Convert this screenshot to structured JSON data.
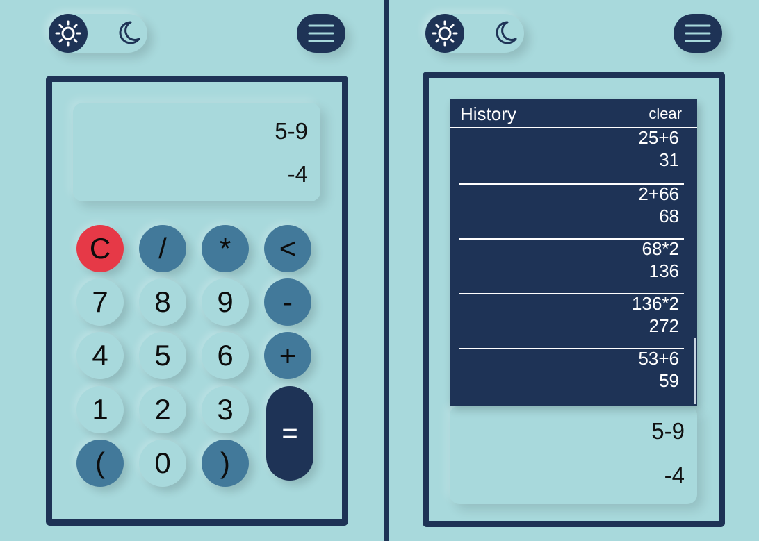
{
  "left": {
    "display": {
      "expression": "5-9",
      "result": "-4"
    },
    "keys": [
      [
        "C",
        "/",
        "*",
        "<"
      ],
      [
        "7",
        "8",
        "9",
        "-"
      ],
      [
        "4",
        "5",
        "6",
        "+"
      ],
      [
        "1",
        "2",
        "3",
        "="
      ],
      [
        "(",
        "0",
        ")"
      ]
    ]
  },
  "right": {
    "history": {
      "title": "History",
      "clear_label": "clear",
      "items": [
        {
          "expression": "25+6",
          "result": "31"
        },
        {
          "expression": "2+66",
          "result": "68"
        },
        {
          "expression": "68*2",
          "result": "136"
        },
        {
          "expression": "136*2",
          "result": "272"
        },
        {
          "expression": "53+6",
          "result": "59"
        }
      ]
    },
    "display": {
      "expression": "5-9",
      "result": "-4"
    }
  },
  "colors": {
    "background": "#a8d9dc",
    "navy": "#1e3356",
    "operator": "#42799a",
    "clear": "#e63947"
  },
  "icons": [
    "sun-icon",
    "moon-icon",
    "hamburger-menu-icon"
  ]
}
